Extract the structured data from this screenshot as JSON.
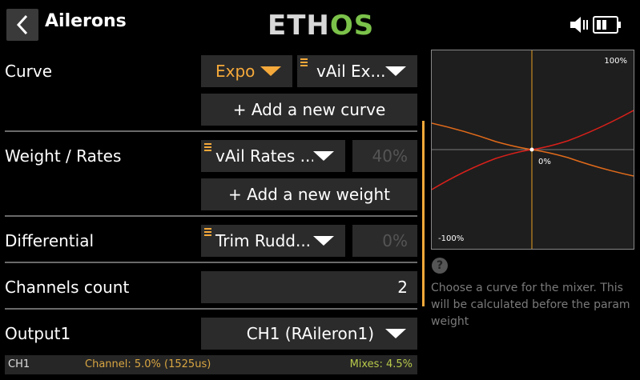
{
  "header": {
    "title": "Ailerons",
    "brand_left": "ETH",
    "brand_right": "OS"
  },
  "rows": {
    "curve": {
      "label": "Curve",
      "type_value": "Expo",
      "curve_value": "vAil Ex...",
      "add_button": "+ Add a new curve"
    },
    "weight": {
      "label": "Weight / Rates",
      "rates_value": "vAil Rates ...",
      "percent": "40%",
      "add_button": "+ Add a new weight"
    },
    "differential": {
      "label": "Differential",
      "source_value": "Trim Rudd...",
      "percent": "0%"
    },
    "channels": {
      "label": "Channels count",
      "value": "2"
    },
    "output": {
      "label": "Output1",
      "value": "CH1 (RAileron1)"
    }
  },
  "status": {
    "channel_id": "CH1",
    "channel_text": "Channel: 5.0% (1525us)",
    "mixes_text": "Mixes: 4.5%"
  },
  "curve_panel": {
    "top_label": "100%",
    "center_label": "0%",
    "bottom_label": "-100%"
  },
  "help": {
    "text": "Choose a curve for the mixer. This will be calculated before the param weight"
  },
  "colors": {
    "accent": "#f5a93a",
    "brand_green": "#7bc24a",
    "curve_orange": "#e06a1a",
    "curve_red": "#d8201a"
  },
  "icons": {
    "back": "chevron-left-icon",
    "speaker": "speaker-icon",
    "battery": "battery-icon",
    "help": "question-circle-icon",
    "list_marker": "list-marker-icon"
  }
}
